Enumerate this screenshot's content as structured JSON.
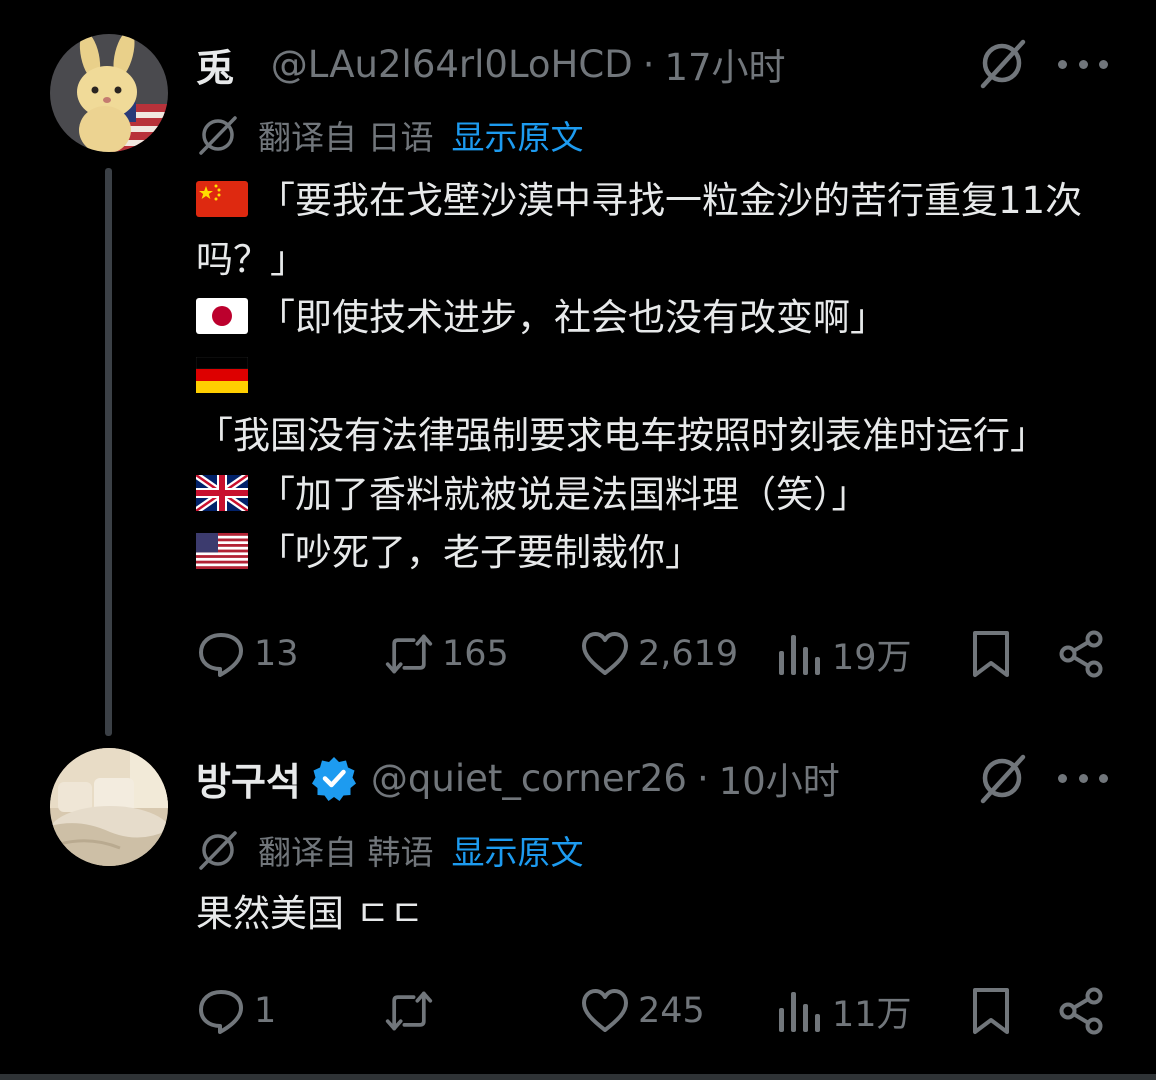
{
  "tweets": [
    {
      "author_name": "兎   ",
      "handle": "@LAu2l64rl0LoHCD",
      "separator": "·",
      "time": "17小时",
      "translated_from": "翻译自 日语",
      "show_original": "显示原文",
      "lines": [
        {
          "flag": "china-flag",
          "text": "「要我在戈壁沙漠中寻找一粒金沙的苦行重复11次吗？」"
        },
        {
          "flag": "japan-flag",
          "text": "「即使技术进步，社会也没有改变啊」"
        },
        {
          "flag": "germany-flag",
          "text": "「我国没有法律强制要求电车按照时刻表准时运行」"
        },
        {
          "flag": "uk-flag",
          "text": "「加了香料就被说是法国料理（笑）」"
        },
        {
          "flag": "usa-flag",
          "text": "「吵死了，老子要制裁你」"
        }
      ],
      "stats": {
        "replies": "13",
        "retweets": "165",
        "likes": "2,619",
        "views": "19万"
      }
    },
    {
      "author_name": "방구석",
      "handle": "@quiet_corner26",
      "separator": "·",
      "time": "10小时",
      "translated_from": "翻译自 韩语",
      "show_original": "显示原文",
      "text": "果然美国 ㄷㄷ",
      "stats": {
        "replies": "1",
        "retweets": "",
        "likes": "245",
        "views": "11万"
      }
    }
  ],
  "colors": {
    "background": "#000000",
    "text": "#e7e9ea",
    "muted": "#71767b",
    "link": "#1d9bf0",
    "verified": "#1d9bf0"
  },
  "icons": [
    "grok-icon",
    "more-icon",
    "translate-icon",
    "reply-icon",
    "retweet-icon",
    "like-icon",
    "views-icon",
    "bookmark-icon",
    "share-icon",
    "verified-badge-icon"
  ]
}
